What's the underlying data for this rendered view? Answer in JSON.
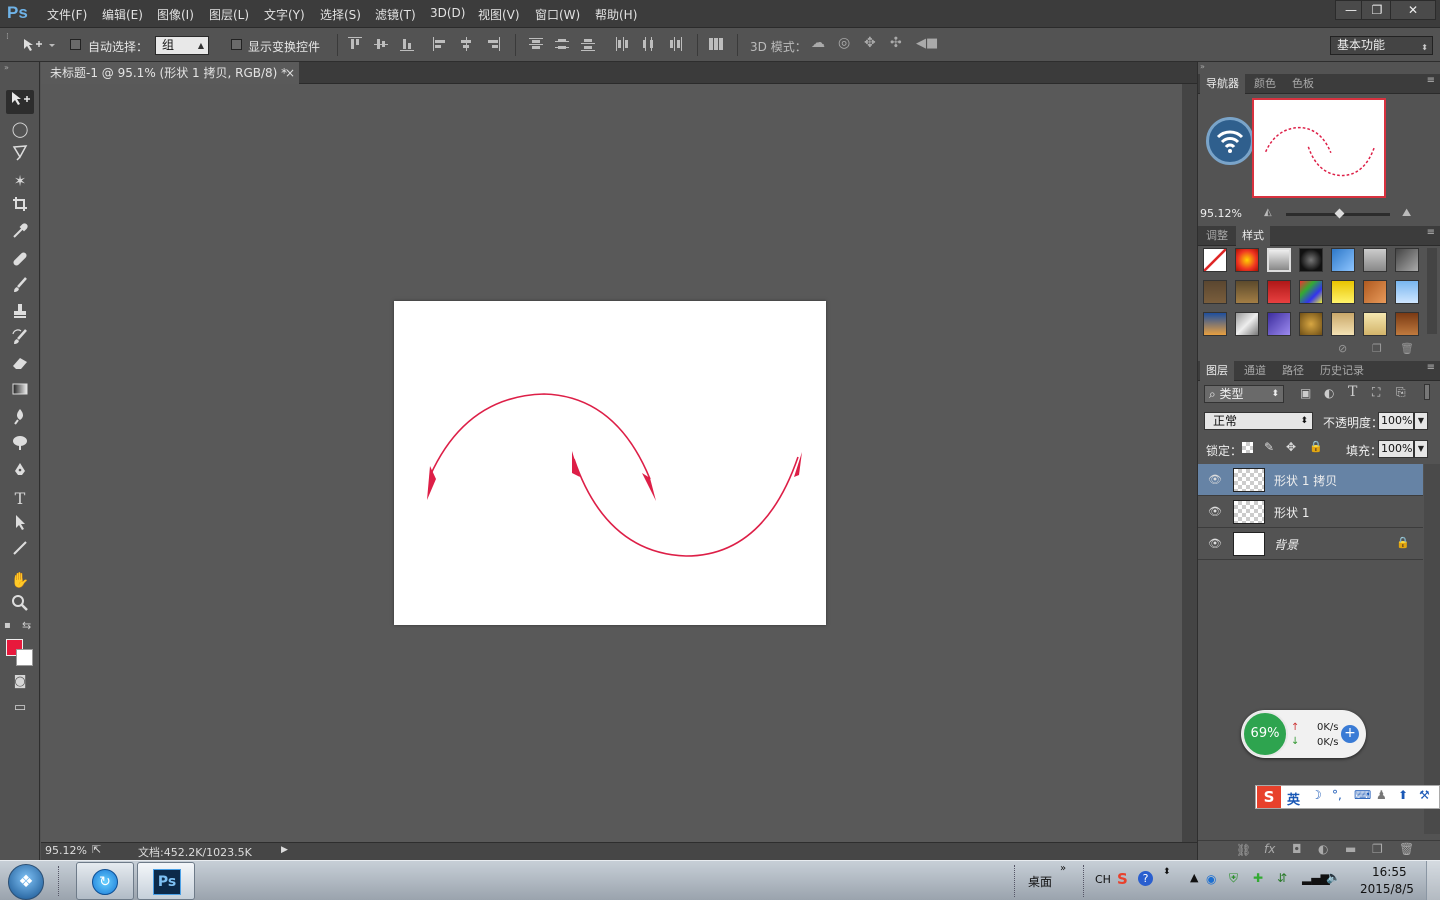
{
  "app": {
    "logo": "Ps"
  },
  "menu": [
    "文件(F)",
    "编辑(E)",
    "图像(I)",
    "图层(L)",
    "文字(Y)",
    "选择(S)",
    "滤镜(T)",
    "3D(D)",
    "视图(V)",
    "窗口(W)",
    "帮助(H)"
  ],
  "window_controls": {
    "minimize": "—",
    "restore": "❐",
    "close": "✕"
  },
  "options": {
    "auto_select_label": "自动选择：",
    "auto_select_value": "组",
    "show_transform_label": "显示变换控件",
    "mode_3d_label": "3D 模式：",
    "workspace": "基本功能"
  },
  "document": {
    "tab_title": "未标题-1 @ 95.1% (形状 1 拷贝, RGB/8) *",
    "tab_close": "×",
    "zoom_status": "95.12%",
    "doc_size": "文档:452.2K/1023.5K"
  },
  "colors": {
    "foreground": "#e8193c",
    "background": "#ffffff",
    "arrow_stroke": "#dd1f47"
  },
  "navigator": {
    "tabs": [
      "导航器",
      "颜色",
      "色板"
    ],
    "zoom": "95.12%"
  },
  "styles_panel": {
    "tabs": [
      "调整",
      "样式"
    ]
  },
  "layers_panel": {
    "tabs": [
      "图层",
      "通道",
      "路径",
      "历史记录"
    ],
    "filter_kind": "类型",
    "blend_mode": "正常",
    "opacity_label": "不透明度：",
    "opacity_value": "100%",
    "lock_label": "锁定：",
    "fill_label": "填充：",
    "fill_value": "100%",
    "layers": [
      {
        "name": "形状 1 拷贝",
        "selected": true
      },
      {
        "name": "形状 1",
        "selected": false
      },
      {
        "name": "背景",
        "selected": false,
        "locked": true
      }
    ],
    "footer_icons": [
      "link-icon",
      "fx-icon",
      "mask-icon",
      "adjustment-icon",
      "folder-icon",
      "new-layer-icon",
      "trash-icon"
    ]
  },
  "net_widget": {
    "percent": "69%",
    "up": "0K/s",
    "down": "0K/s"
  },
  "ime": {
    "logo": "S",
    "lang": "英"
  },
  "taskbar": {
    "desktop_label": "桌面",
    "ime_label": "CH",
    "time": "16:55",
    "date": "2015/8/5"
  }
}
